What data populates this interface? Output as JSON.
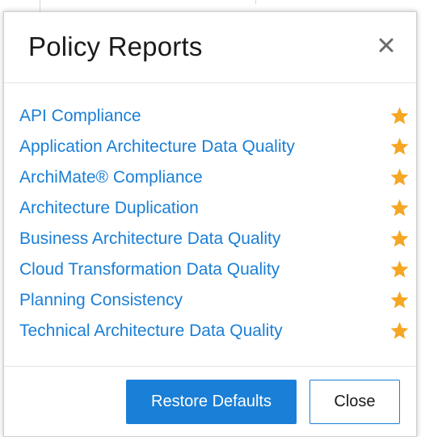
{
  "dialog": {
    "title": "Policy Reports",
    "close_icon": "close-icon",
    "reports": [
      {
        "label": "API Compliance",
        "favorite": true
      },
      {
        "label": "Application Architecture Data Quality",
        "favorite": true
      },
      {
        "label": "ArchiMate® Compliance",
        "favorite": true
      },
      {
        "label": "Architecture Duplication",
        "favorite": true
      },
      {
        "label": "Business Architecture Data Quality",
        "favorite": true
      },
      {
        "label": "Cloud Transformation Data Quality",
        "favorite": true
      },
      {
        "label": "Planning Consistency",
        "favorite": true
      },
      {
        "label": "Technical Architecture Data Quality",
        "favorite": true
      }
    ],
    "star_icon": "star-icon",
    "buttons": {
      "restore_defaults": "Restore Defaults",
      "close": "Close"
    }
  },
  "colors": {
    "link": "#1a7fd6",
    "star": "#f5a623",
    "primary_button": "#1a7fd6",
    "title_text": "#1a1a1a"
  }
}
